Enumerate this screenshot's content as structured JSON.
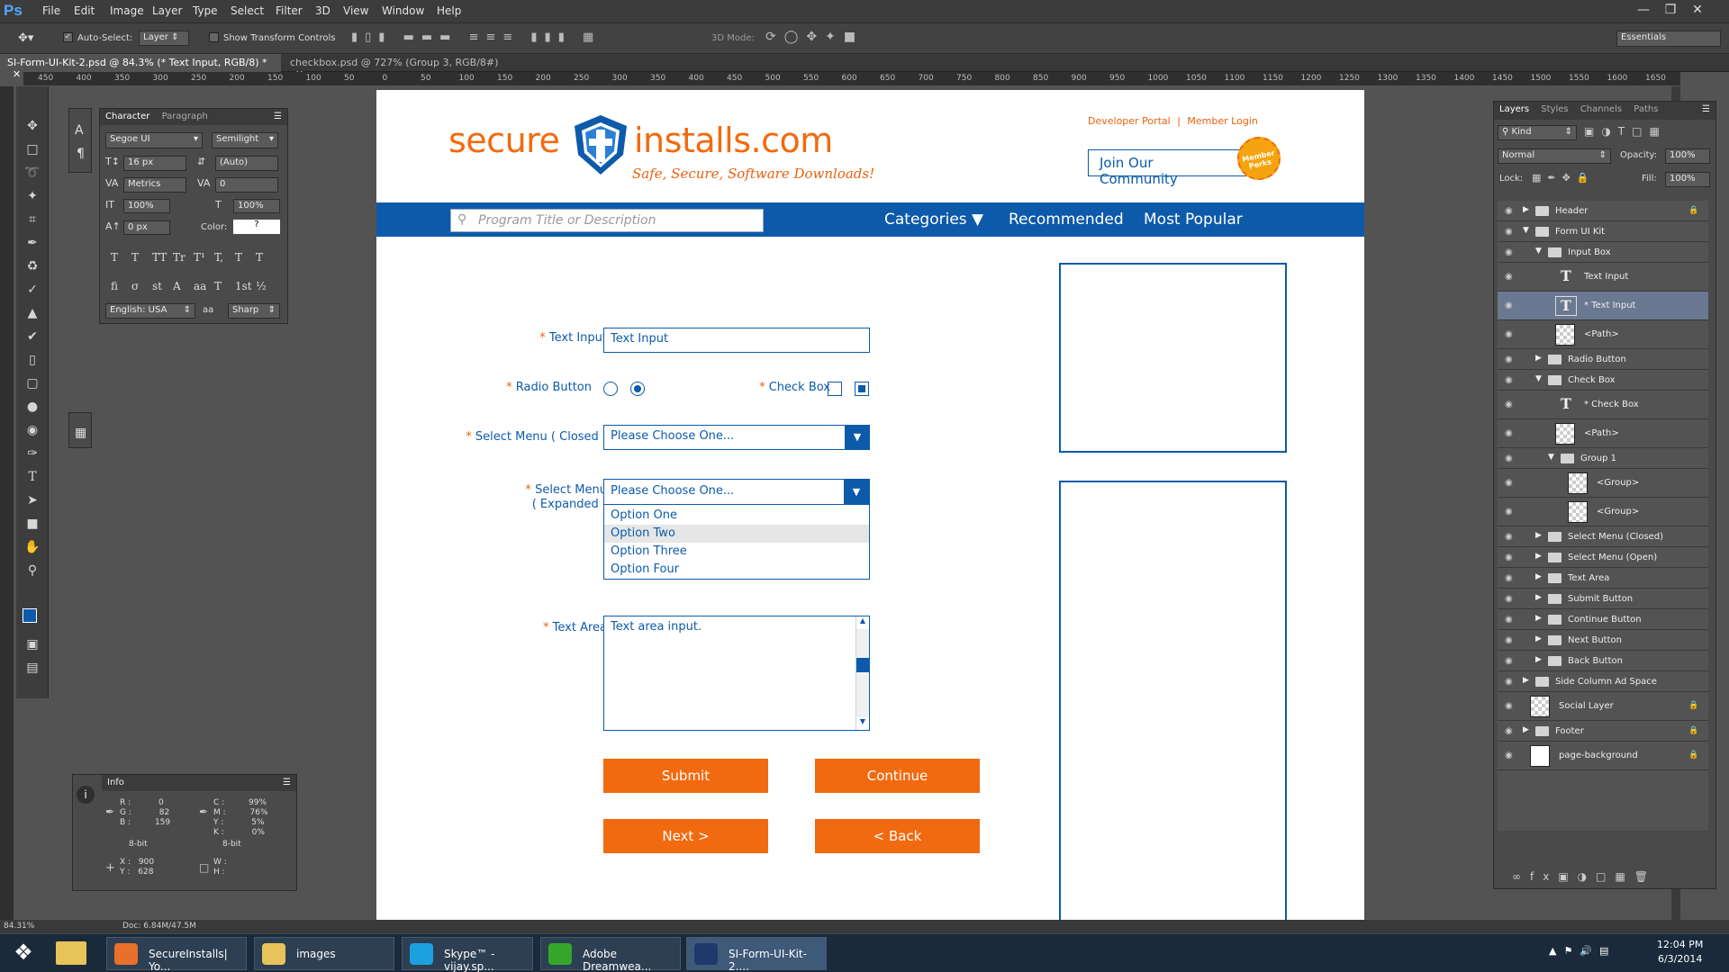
{
  "app": {
    "logo": "Ps"
  },
  "menu": [
    "File",
    "Edit",
    "Image",
    "Layer",
    "Type",
    "Select",
    "Filter",
    "3D",
    "View",
    "Window",
    "Help"
  ],
  "options": {
    "auto_select_label": "Auto-Select:",
    "auto_select_value": "Layer",
    "show_transform": "Show Transform Controls",
    "mode_3d": "3D Mode:",
    "workspace": "Essentials"
  },
  "doc_tabs": [
    {
      "label": "SI-Form-UI-Kit-2.psd @ 84.3% (* Text Input, RGB/8) *"
    },
    {
      "label": "checkbox.psd @ 727% (Group 3, RGB/8#)"
    }
  ],
  "ruler_ticks": [
    "450",
    "400",
    "350",
    "300",
    "250",
    "200",
    "150",
    "100",
    "50",
    "0",
    "50",
    "100",
    "150",
    "200",
    "250",
    "300",
    "350",
    "400",
    "450",
    "500",
    "550",
    "600",
    "650",
    "700",
    "750",
    "800",
    "850",
    "900",
    "950",
    "1000",
    "1050",
    "1100",
    "1150",
    "1200",
    "1250",
    "1300",
    "1350",
    "1400",
    "1450",
    "1500",
    "1550",
    "1600",
    "1650"
  ],
  "character_panel": {
    "tabs": [
      "Character",
      "Paragraph"
    ],
    "font_family": "Segoe UI",
    "font_style": "Semilight",
    "size": "16 px",
    "leading": "(Auto)",
    "kerning": "Metrics",
    "tracking": "0",
    "vscale": "100%",
    "hscale": "100%",
    "baseline": "0 px",
    "color_label": "Color:",
    "color_value": "?",
    "language": "English: USA",
    "aa_label": "a",
    "antialias": "Sharp",
    "type_styles": [
      "T",
      "T",
      "TT",
      "Tr",
      "T¹",
      "T,",
      "T",
      "T"
    ],
    "opentype": [
      "fi",
      "σ",
      "st",
      "A",
      "aa",
      "T",
      "1st",
      "½"
    ]
  },
  "info_panel": {
    "title": "Info",
    "rgb": {
      "R": "0",
      "G": "82",
      "B": "159"
    },
    "cmyk": {
      "C": "99%",
      "M": "76%",
      "Y": "5%",
      "K": "0%"
    },
    "bit_left": "8-bit",
    "bit_right": "8-bit",
    "x": "900",
    "y": "628",
    "w": "",
    "h": ""
  },
  "site": {
    "logo_left": "secure",
    "logo_right": "installs.com",
    "tagline": "Safe, Secure, Software Downloads!",
    "top_links": [
      "Developer Portal",
      "|",
      "Member Login"
    ],
    "join_button": "Join Our Community",
    "perks_badge": "Member Perks",
    "search_placeholder": "Program Title or Description",
    "nav": {
      "categories": "Categories",
      "recommended": "Recommended",
      "popular": "Most Popular"
    }
  },
  "form": {
    "text_input_label": "Text Input",
    "text_input_value": "Text Input",
    "radio_label": "Radio Button",
    "checkbox_label": "Check Box",
    "select_closed_label": "Select Menu ( Closed )",
    "select_closed_value": "Please Choose One...",
    "select_expanded_label_1": "Select Menu",
    "select_expanded_label_2": "( Expanded )",
    "select_expanded_value": "Please Choose One...",
    "options": [
      "Option One",
      "Option Two",
      "Option Three",
      "Option Four"
    ],
    "highlighted_option": "Option Two",
    "textarea_label": "Text Area",
    "textarea_value": "Text area input.",
    "required_mark": "*",
    "buttons": {
      "submit": "Submit",
      "continue": "Continue",
      "next": "Next >",
      "back": "< Back"
    }
  },
  "layers_panel": {
    "tabs": [
      "Layers",
      "Styles",
      "Channels",
      "Paths"
    ],
    "kind": "Kind",
    "blend_mode": "Normal",
    "opacity_label": "Opacity:",
    "opacity": "100%",
    "lock_label": "Lock:",
    "fill_label": "Fill:",
    "fill": "100%",
    "layers": [
      {
        "name": "Header",
        "type": "folder",
        "indent": 0,
        "locked": true
      },
      {
        "name": "Form UI Kit",
        "type": "folder-open",
        "indent": 0
      },
      {
        "name": "Input Box",
        "type": "folder-open",
        "indent": 1
      },
      {
        "name": "Text Input",
        "type": "text",
        "indent": 2
      },
      {
        "name": "* Text Input",
        "type": "text",
        "indent": 2,
        "selected": true
      },
      {
        "name": "<Path>",
        "type": "thumb",
        "indent": 2
      },
      {
        "name": "Radio Button",
        "type": "folder",
        "indent": 1
      },
      {
        "name": "Check Box",
        "type": "folder-open",
        "indent": 1
      },
      {
        "name": "* Check Box",
        "type": "text",
        "indent": 2
      },
      {
        "name": "<Path>",
        "type": "thumb",
        "indent": 2
      },
      {
        "name": "Group 1",
        "type": "folder-open",
        "indent": 2
      },
      {
        "name": "<Group>",
        "type": "thumb",
        "indent": 3
      },
      {
        "name": "<Group>",
        "type": "thumb",
        "indent": 3
      },
      {
        "name": "Select Menu (Closed)",
        "type": "folder",
        "indent": 1
      },
      {
        "name": "Select Menu (Open)",
        "type": "folder",
        "indent": 1
      },
      {
        "name": "Text Area",
        "type": "folder",
        "indent": 1
      },
      {
        "name": "Submit Button",
        "type": "folder",
        "indent": 1
      },
      {
        "name": "Continue Button",
        "type": "folder",
        "indent": 1
      },
      {
        "name": "Next Button",
        "type": "folder",
        "indent": 1
      },
      {
        "name": "Back Button",
        "type": "folder",
        "indent": 1
      },
      {
        "name": "Side Column Ad Space",
        "type": "folder",
        "indent": 0
      },
      {
        "name": "Social Layer",
        "type": "thumb",
        "indent": 0,
        "locked": true
      },
      {
        "name": "Footer",
        "type": "folder",
        "indent": 0,
        "locked": true
      },
      {
        "name": "page-background",
        "type": "white",
        "indent": 0,
        "locked": true
      }
    ]
  },
  "status": {
    "zoom": "84.31%",
    "doc": "Doc: 6.84M/47.5M"
  },
  "taskbar": {
    "items": [
      {
        "label": "SecureInstalls| Yo...",
        "icon": "firefox-icon"
      },
      {
        "label": "images",
        "icon": "folder-icon"
      },
      {
        "label": "Skype™ - vijay.sp...",
        "icon": "skype-icon"
      },
      {
        "label": "Adobe Dreamwea...",
        "icon": "dreamweaver-icon"
      },
      {
        "label": "SI-Form-UI-Kit-2....",
        "icon": "photoshop-icon"
      }
    ],
    "time": "12:04 PM",
    "date": "6/3/2014"
  },
  "colors": {
    "brand_blue": "#0d5aab",
    "brand_orange": "#f26a0f"
  }
}
